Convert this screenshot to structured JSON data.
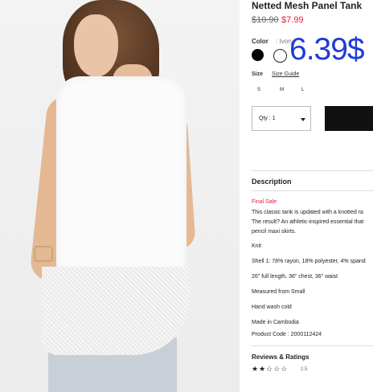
{
  "product": {
    "title": "Netted Mesh Panel Tank",
    "price_old": "$10.90",
    "price_new": "$7.99",
    "overlay_price": "6.39$"
  },
  "color": {
    "label": "Color",
    "value": ": Ivory",
    "swatches": [
      "black",
      "ivory"
    ]
  },
  "size": {
    "label": "Size",
    "guide": "Size Guide",
    "options": [
      "S",
      "M",
      "L"
    ]
  },
  "qty": {
    "label": "Qty : 1"
  },
  "description": {
    "heading": "Description",
    "sale": "Final Sale",
    "lines": [
      "This classic tank is updated with a knotted ra",
      "The result? An athletic-inspired essential that",
      "pencil maxi skirts.",
      "Knit",
      "Shell 1: 78% rayon, 18% polyester, 4% spand",
      "26\" full length, 36\" chest, 36\" waist",
      "Measured from Small",
      "Hand wash cold",
      "Made in Cambodia",
      "Product Code : 2000112424"
    ]
  },
  "reviews": {
    "heading": "Reviews & Ratings",
    "stars": "★★☆☆☆",
    "rating": "2.5"
  }
}
